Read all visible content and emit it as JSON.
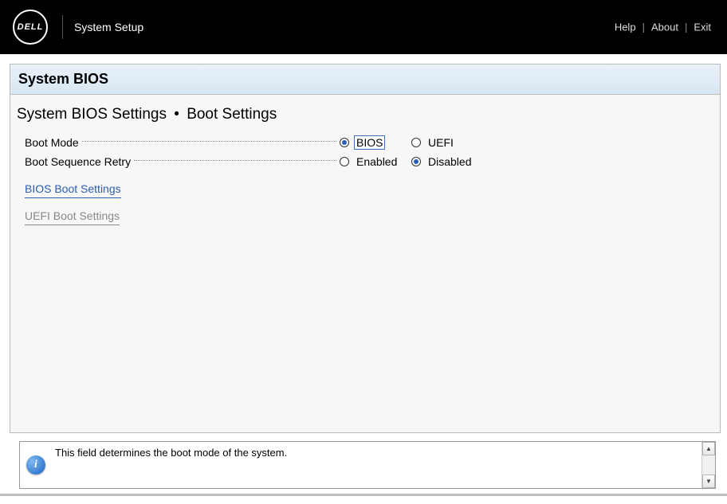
{
  "header": {
    "brand": "DELL",
    "title": "System Setup",
    "links": {
      "help": "Help",
      "about": "About",
      "exit": "Exit"
    }
  },
  "panel": {
    "title": "System BIOS",
    "breadcrumb": {
      "a": "System BIOS Settings",
      "sep": "•",
      "b": "Boot Settings"
    }
  },
  "settings": {
    "boot_mode": {
      "label": "Boot Mode",
      "options": {
        "bios": "BIOS",
        "uefi": "UEFI"
      },
      "selected": "bios"
    },
    "boot_seq_retry": {
      "label": "Boot Sequence Retry",
      "options": {
        "enabled": "Enabled",
        "disabled": "Disabled"
      },
      "selected": "disabled"
    }
  },
  "links": {
    "bios_boot": "BIOS Boot Settings",
    "uefi_boot": "UEFI Boot Settings"
  },
  "help": {
    "text": "This field determines the boot mode of the system."
  }
}
